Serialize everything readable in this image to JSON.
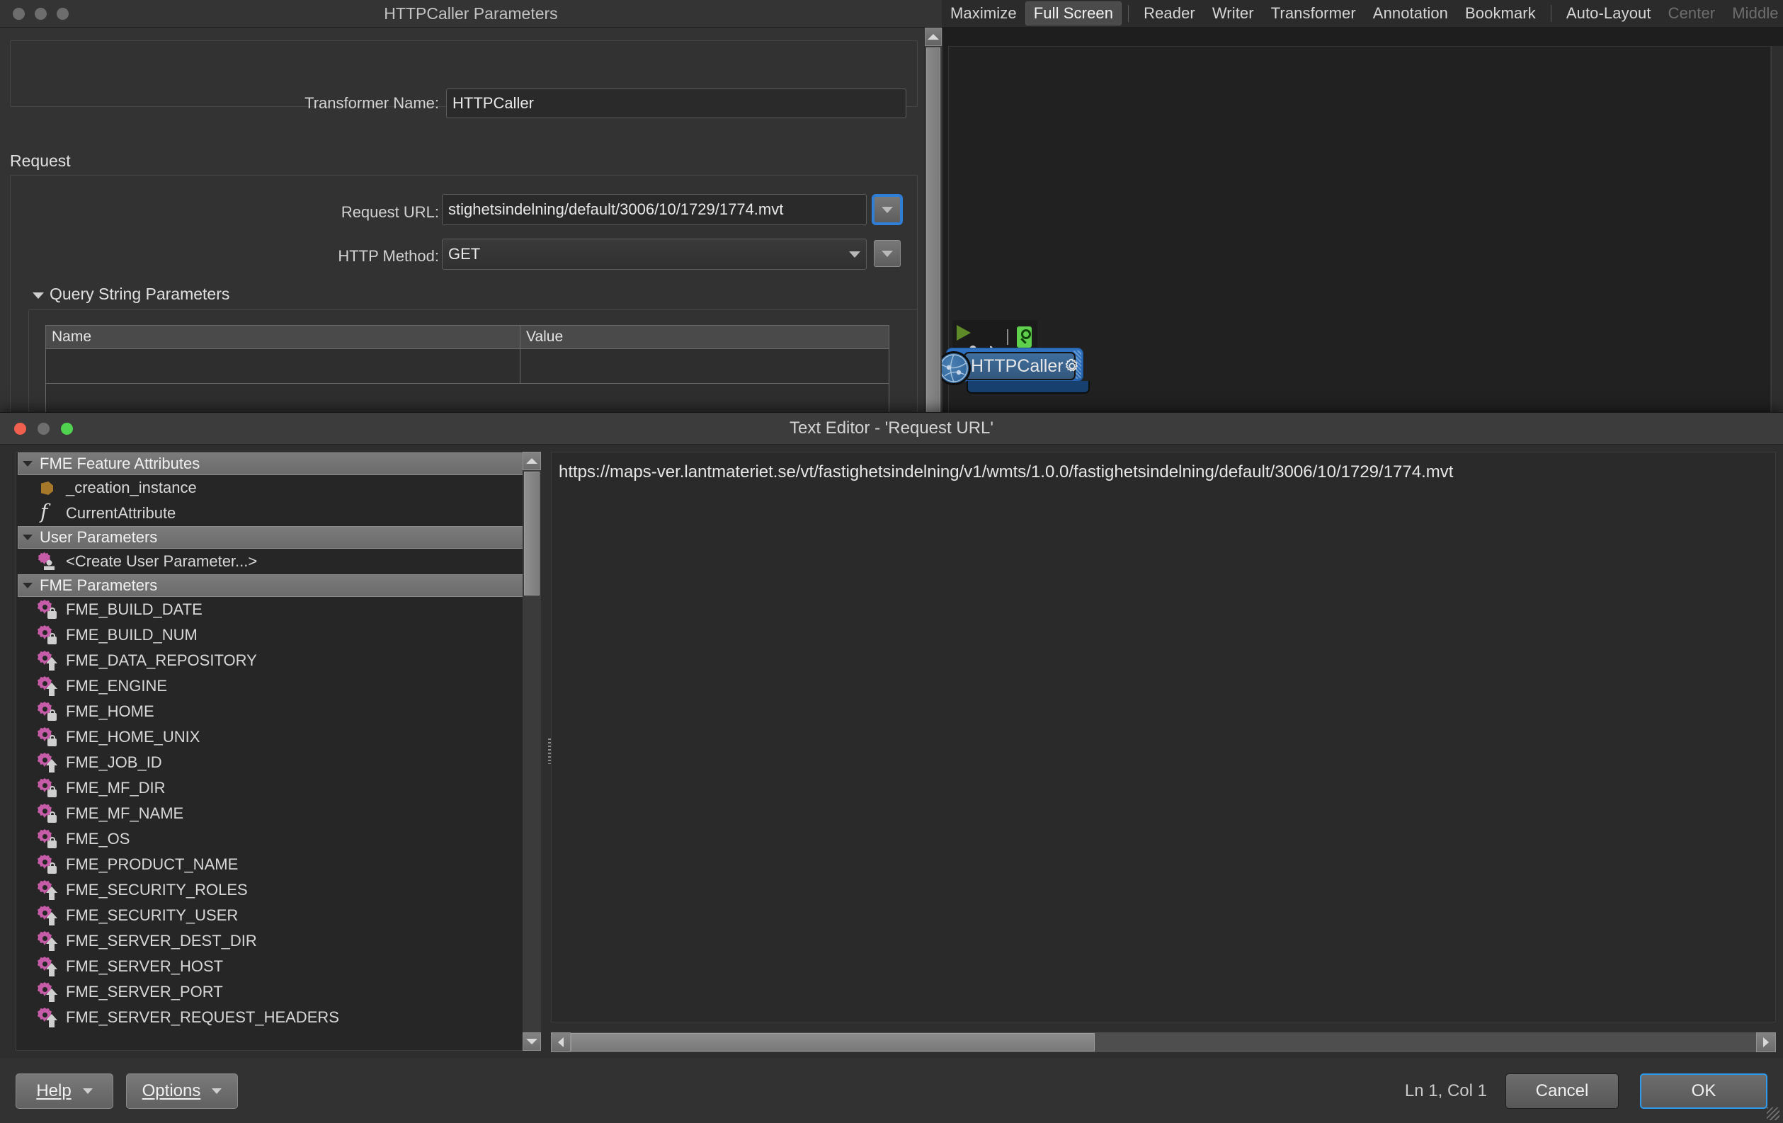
{
  "ribbon": {
    "items": [
      {
        "label": "Maximize",
        "state": "normal"
      },
      {
        "label": "Full Screen",
        "state": "active"
      },
      {
        "label": "Reader",
        "state": "normal"
      },
      {
        "label": "Writer",
        "state": "normal"
      },
      {
        "label": "Transformer",
        "state": "normal"
      },
      {
        "label": "Annotation",
        "state": "normal"
      },
      {
        "label": "Bookmark",
        "state": "normal"
      },
      {
        "label": "Auto-Layout",
        "state": "normal"
      },
      {
        "label": "Center",
        "state": "dim"
      },
      {
        "label": "Middle",
        "state": "dim"
      }
    ]
  },
  "canvas": {
    "node": {
      "label": "HTTPCaller"
    }
  },
  "params_window": {
    "title": "HTTPCaller Parameters",
    "transformer_name_label": "Transformer Name:",
    "transformer_name_value": "HTTPCaller",
    "request_section_title": "Request",
    "request_url_label": "Request URL:",
    "request_url_value": "stighetsindelning/default/3006/10/1729/1774.mvt",
    "http_method_label": "HTTP Method:",
    "http_method_value": "GET",
    "query_params_title": "Query String Parameters",
    "query_table": {
      "columns": [
        "Name",
        "Value"
      ],
      "rows": [
        [
          "",
          ""
        ]
      ]
    }
  },
  "editor_window": {
    "title": "Text Editor - 'Request URL'",
    "content": "https://maps-ver.lantmateriet.se/vt/fastighetsindelning/v1/wmts/1.0.0/fastighetsindelning/default/3006/10/1729/1774.mvt",
    "status": "Ln 1, Col 1",
    "buttons": {
      "help": "Help",
      "options": "Options",
      "cancel": "Cancel",
      "ok": "OK"
    },
    "tree": [
      {
        "type": "group",
        "label": "FME Feature Attributes"
      },
      {
        "type": "item",
        "label": "_creation_instance",
        "icon": "attribute-icon",
        "badge": "none"
      },
      {
        "type": "item",
        "label": "CurrentAttribute",
        "icon": "function-icon",
        "badge": "none"
      },
      {
        "type": "group",
        "label": "User Parameters"
      },
      {
        "type": "item",
        "label": "<Create User Parameter...>",
        "icon": "user-parameter-icon",
        "badge": "none"
      },
      {
        "type": "group",
        "label": "FME Parameters"
      },
      {
        "type": "item",
        "label": "FME_BUILD_DATE",
        "icon": "gear-icon",
        "badge": "lock"
      },
      {
        "type": "item",
        "label": "FME_BUILD_NUM",
        "icon": "gear-icon",
        "badge": "lock"
      },
      {
        "type": "item",
        "label": "FME_DATA_REPOSITORY",
        "icon": "gear-icon",
        "badge": "up"
      },
      {
        "type": "item",
        "label": "FME_ENGINE",
        "icon": "gear-icon",
        "badge": "up"
      },
      {
        "type": "item",
        "label": "FME_HOME",
        "icon": "gear-icon",
        "badge": "lock"
      },
      {
        "type": "item",
        "label": "FME_HOME_UNIX",
        "icon": "gear-icon",
        "badge": "lock"
      },
      {
        "type": "item",
        "label": "FME_JOB_ID",
        "icon": "gear-icon",
        "badge": "up"
      },
      {
        "type": "item",
        "label": "FME_MF_DIR",
        "icon": "gear-icon",
        "badge": "lock"
      },
      {
        "type": "item",
        "label": "FME_MF_NAME",
        "icon": "gear-icon",
        "badge": "lock"
      },
      {
        "type": "item",
        "label": "FME_OS",
        "icon": "gear-icon",
        "badge": "lock"
      },
      {
        "type": "item",
        "label": "FME_PRODUCT_NAME",
        "icon": "gear-icon",
        "badge": "lock"
      },
      {
        "type": "item",
        "label": "FME_SECURITY_ROLES",
        "icon": "gear-icon",
        "badge": "up"
      },
      {
        "type": "item",
        "label": "FME_SECURITY_USER",
        "icon": "gear-icon",
        "badge": "up"
      },
      {
        "type": "item",
        "label": "FME_SERVER_DEST_DIR",
        "icon": "gear-icon",
        "badge": "up"
      },
      {
        "type": "item",
        "label": "FME_SERVER_HOST",
        "icon": "gear-icon",
        "badge": "up"
      },
      {
        "type": "item",
        "label": "FME_SERVER_PORT",
        "icon": "gear-icon",
        "badge": "up"
      },
      {
        "type": "item",
        "label": "FME_SERVER_REQUEST_HEADERS",
        "icon": "gear-icon",
        "badge": "up"
      }
    ]
  },
  "colors": {
    "accent_blue": "#2f9bea",
    "node_blue": "#2f72c2",
    "param_pink": "#c65ca8",
    "attribute_gold": "#a5782a",
    "mag_green": "#5ed04c"
  }
}
